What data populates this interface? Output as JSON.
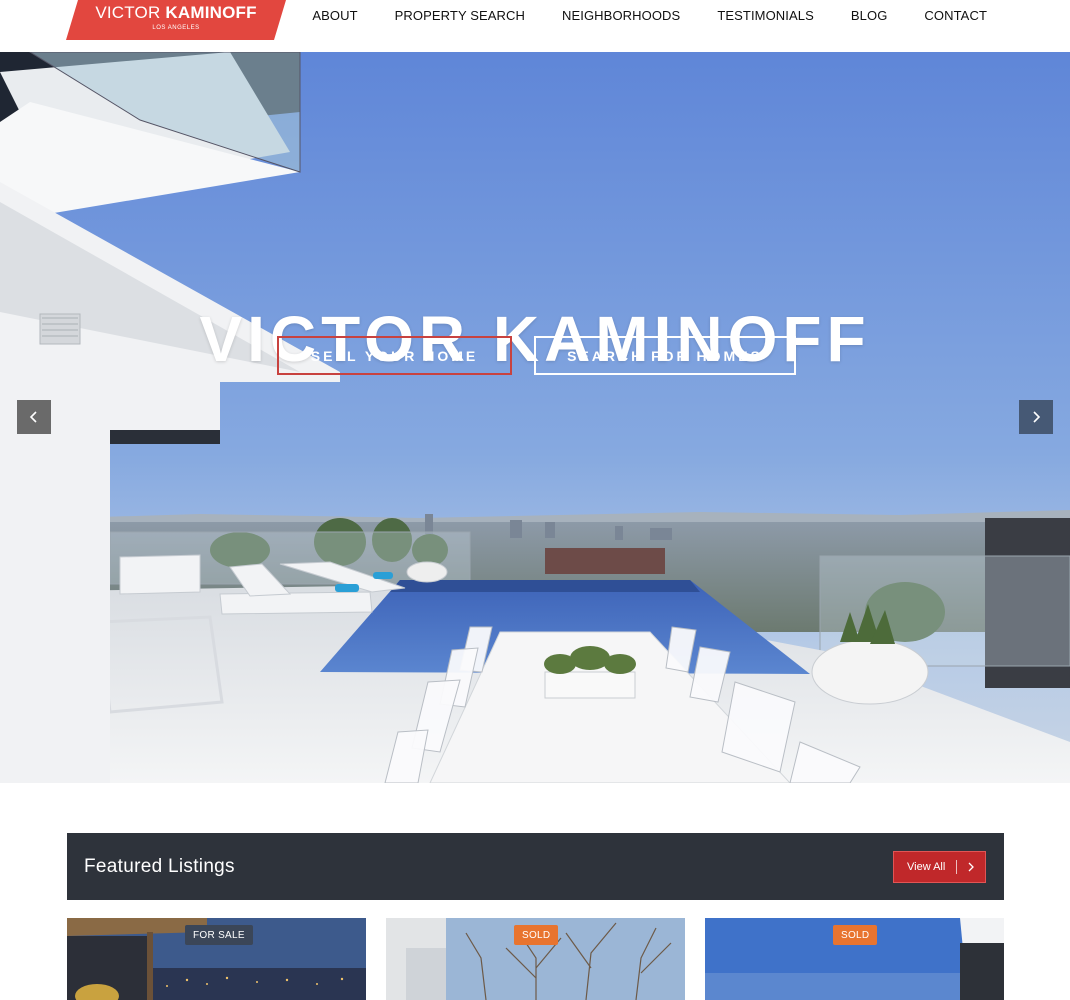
{
  "brand": {
    "first_name": "VICTOR",
    "last_name": "KAMINOFF",
    "location": "LOS ANGELES",
    "color": "#e2473f"
  },
  "nav": {
    "items": [
      "ABOUT",
      "PROPERTY SEARCH",
      "NEIGHBORHOODS",
      "TESTIMONIALS",
      "BLOG",
      "CONTACT"
    ]
  },
  "hero": {
    "title": "VICTOR KAMINOFF",
    "sell_label": "SELL YOUR HOME",
    "search_label": "SEARCH FOR HOMES",
    "prev_icon": "chevron-left-icon",
    "next_icon": "chevron-right-icon"
  },
  "featured": {
    "title": "Featured Listings",
    "view_all_label": "View All",
    "view_all_icon": "chevron-right-icon",
    "button_color": "#c0282a",
    "bar_color": "#2e333b"
  },
  "listings": [
    {
      "badge": "FOR SALE",
      "badge_color": "#3b4658"
    },
    {
      "badge": "SOLD",
      "badge_color": "#e8742f"
    },
    {
      "badge": "SOLD",
      "badge_color": "#e8742f"
    }
  ]
}
